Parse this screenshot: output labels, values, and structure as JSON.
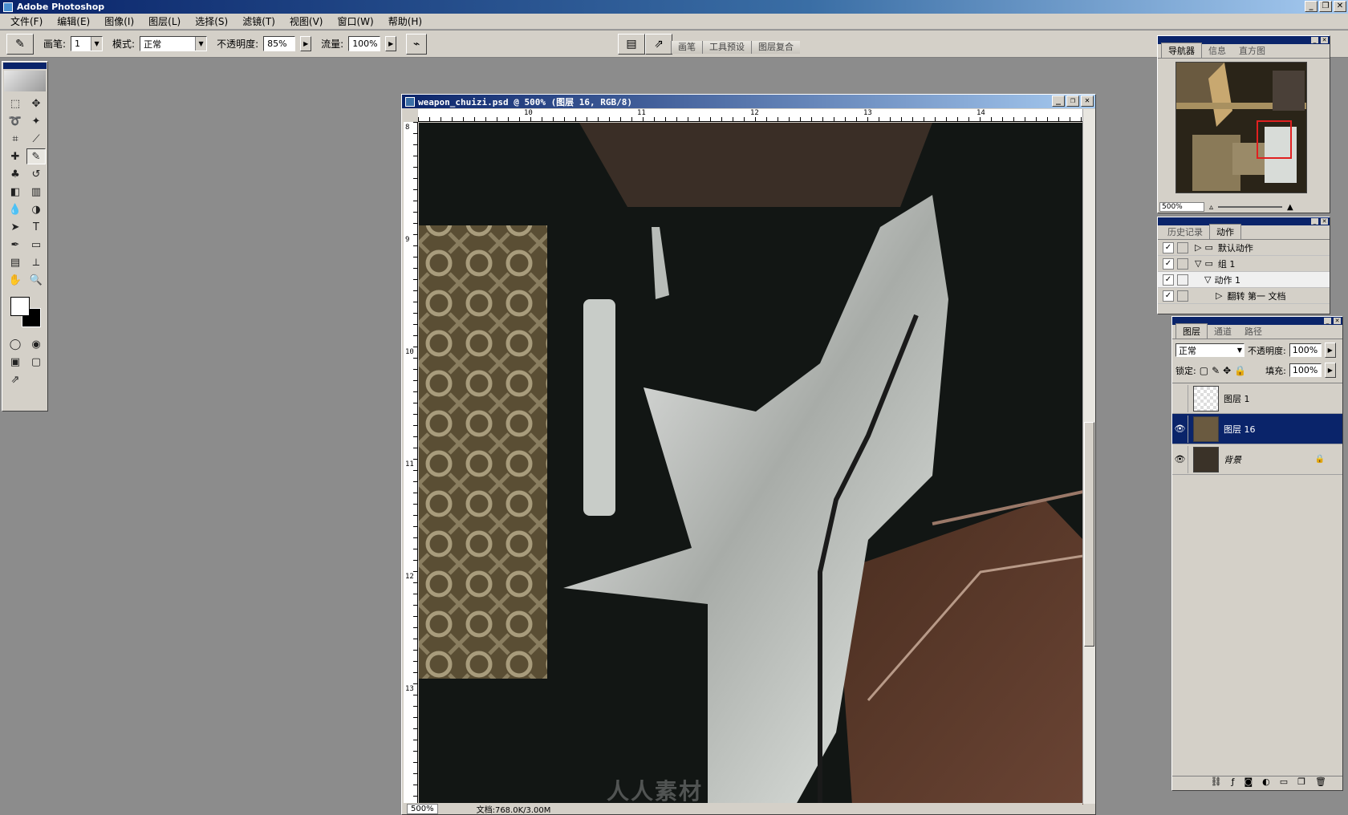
{
  "app": {
    "title": "Adobe Photoshop"
  },
  "window_controls": {
    "minimize": "_",
    "restore": "❐",
    "close": "✕"
  },
  "menu": [
    "文件(F)",
    "编辑(E)",
    "图像(I)",
    "图层(L)",
    "选择(S)",
    "滤镜(T)",
    "视图(V)",
    "窗口(W)",
    "帮助(H)"
  ],
  "options": {
    "brush_label": "画笔:",
    "brush_size": "1",
    "mode_label": "模式:",
    "mode_value": "正常",
    "opacity_label": "不透明度:",
    "opacity_value": "85%",
    "flow_label": "流量:",
    "flow_value": "100%"
  },
  "palette_well": [
    "画笔",
    "工具预设",
    "图层复合"
  ],
  "document": {
    "title": "weapon_chuizi.psd @ 500% (图层 16, RGB/8)",
    "ruler_h": [
      "10",
      "11",
      "12",
      "13",
      "14"
    ],
    "ruler_v": [
      "8",
      "9",
      "10",
      "11",
      "12",
      "13"
    ],
    "status_zoom": "500%",
    "status_doc": "文档:768.0K/3.00M"
  },
  "navigator": {
    "tabs": [
      "导航器",
      "信息",
      "直方图"
    ],
    "zoom": "500%"
  },
  "history": {
    "tabs": [
      "历史记录",
      "动作"
    ],
    "actions": [
      {
        "label": "默认动作",
        "indent": 0,
        "type": "folder",
        "expanded": false
      },
      {
        "label": "组 1",
        "indent": 0,
        "type": "folder",
        "expanded": true
      },
      {
        "label": "动作 1",
        "indent": 1,
        "type": "action",
        "expanded": true
      },
      {
        "label": "翻转 第一 文档",
        "indent": 2,
        "type": "step",
        "expanded": false
      }
    ]
  },
  "layers": {
    "tabs": [
      "图层",
      "通道",
      "路径"
    ],
    "blend_mode": "正常",
    "opacity_label": "不透明度:",
    "opacity_value": "100%",
    "lock_label": "锁定:",
    "fill_label": "填充:",
    "fill_value": "100%",
    "items": [
      {
        "name": "图层 1",
        "visible": false,
        "selected": false,
        "locked": false
      },
      {
        "name": "图层 16",
        "visible": true,
        "selected": true,
        "locked": false
      },
      {
        "name": "背景",
        "visible": true,
        "selected": false,
        "locked": true
      }
    ]
  },
  "watermark": "人人素材",
  "colors": {
    "selection": "#0a246a",
    "chrome": "#d4d0c8",
    "workspace": "#8c8c8c"
  }
}
